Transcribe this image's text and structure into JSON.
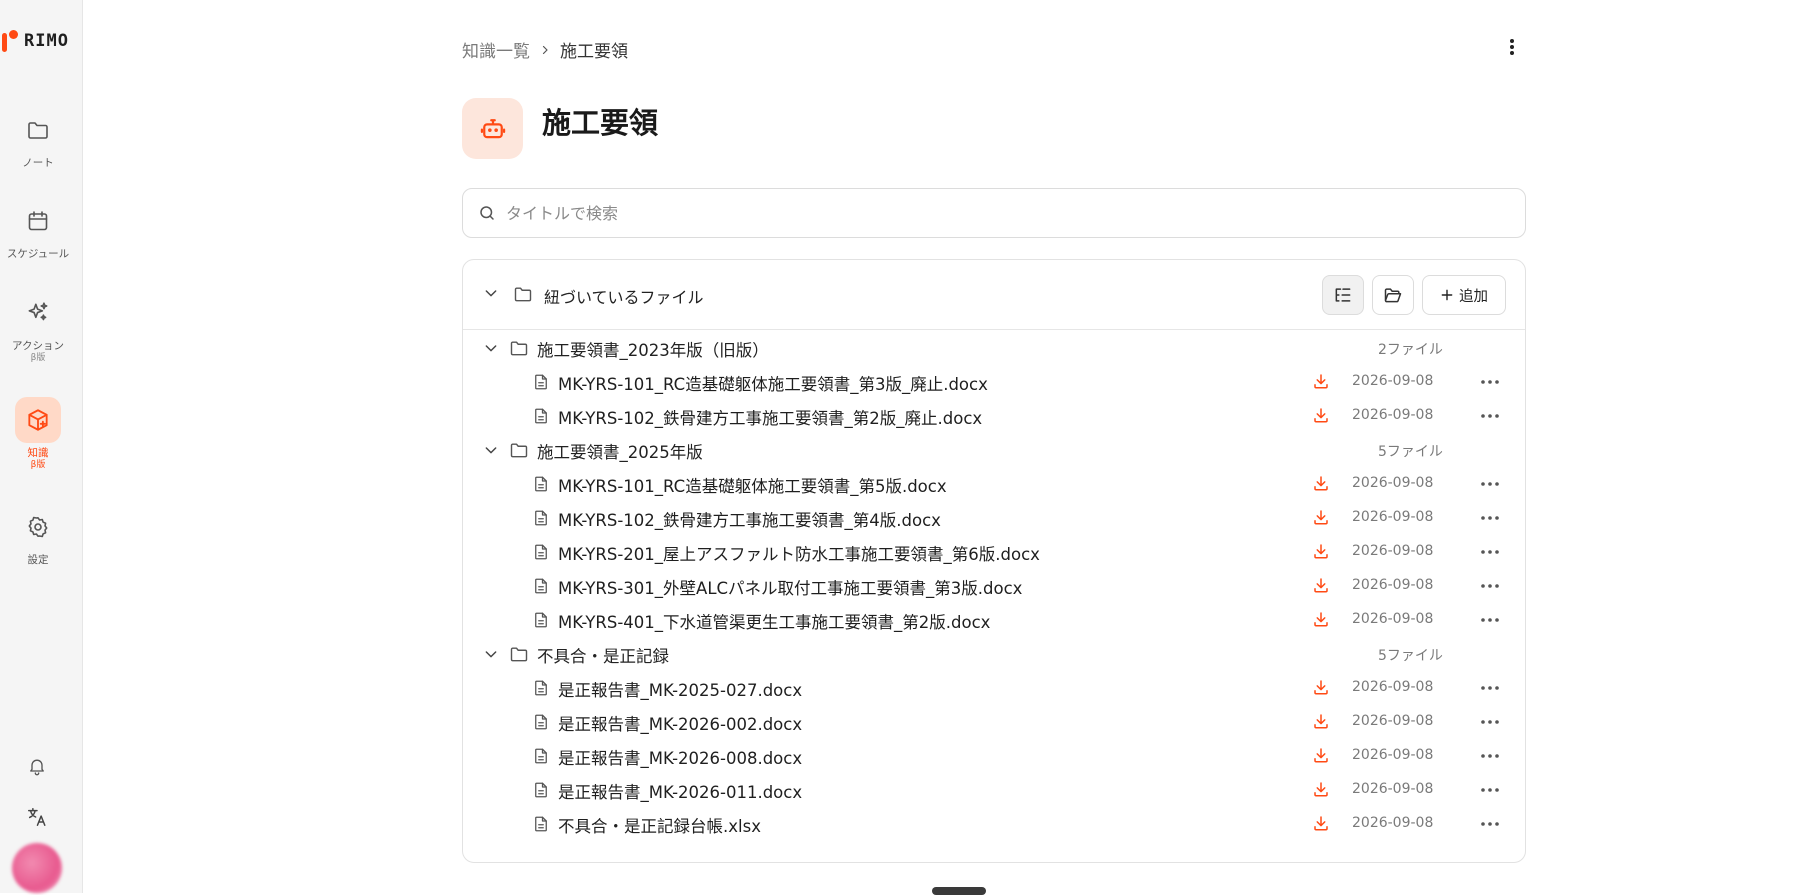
{
  "app": {
    "logo_text": "RIMO"
  },
  "sidebar": {
    "items": [
      {
        "label": "ノート",
        "sub": "",
        "icon": "folder-icon"
      },
      {
        "label": "スケジュール",
        "sub": "",
        "icon": "calendar-icon"
      },
      {
        "label": "アクション",
        "sub": "β版",
        "icon": "sparkles-icon"
      },
      {
        "label": "知識",
        "sub": "β版",
        "icon": "knowledge-box-icon",
        "active": true
      },
      {
        "label": "設定",
        "sub": "",
        "icon": "gear-icon"
      }
    ],
    "bottom_icons": [
      "bell-icon",
      "translate-icon"
    ]
  },
  "breadcrumb": {
    "parent": "知識一覧",
    "current": "施工要領"
  },
  "page": {
    "title": "施工要領",
    "icon": "robot-icon"
  },
  "search": {
    "placeholder": "タイトルで検索",
    "value": ""
  },
  "panel": {
    "title": "紐づいているファイル",
    "add_label": "追加",
    "groups": [
      {
        "name": "施工要領書_2023年版（旧版）",
        "count": "2ファイル",
        "files": [
          {
            "name": "MK-YRS-101_RC造基礎躯体施工要領書_第3版_廃止.docx",
            "date": "2026-09-08"
          },
          {
            "name": "MK-YRS-102_鉄骨建方工事施工要領書_第2版_廃止.docx",
            "date": "2026-09-08"
          }
        ]
      },
      {
        "name": "施工要領書_2025年版",
        "count": "5ファイル",
        "files": [
          {
            "name": "MK-YRS-101_RC造基礎躯体施工要領書_第5版.docx",
            "date": "2026-09-08"
          },
          {
            "name": "MK-YRS-102_鉄骨建方工事施工要領書_第4版.docx",
            "date": "2026-09-08"
          },
          {
            "name": "MK-YRS-201_屋上アスファルト防水工事施工要領書_第6版.docx",
            "date": "2026-09-08"
          },
          {
            "name": "MK-YRS-301_外壁ALCパネル取付工事施工要領書_第3版.docx",
            "date": "2026-09-08"
          },
          {
            "name": "MK-YRS-401_下水道管渠更生工事施工要領書_第2版.docx",
            "date": "2026-09-08"
          }
        ]
      },
      {
        "name": "不具合・是正記録",
        "count": "5ファイル",
        "files": [
          {
            "name": "是正報告書_MK-2025-027.docx",
            "date": "2026-09-08"
          },
          {
            "name": "是正報告書_MK-2026-002.docx",
            "date": "2026-09-08"
          },
          {
            "name": "是正報告書_MK-2026-008.docx",
            "date": "2026-09-08"
          },
          {
            "name": "是正報告書_MK-2026-011.docx",
            "date": "2026-09-08"
          },
          {
            "name": "不具合・是正記録台帳.xlsx",
            "date": "2026-09-08"
          }
        ]
      }
    ]
  },
  "colors": {
    "accent": "#ff4a14",
    "active_bg": "#ffd9c7",
    "title_icon_bg": "#fde6dc"
  }
}
